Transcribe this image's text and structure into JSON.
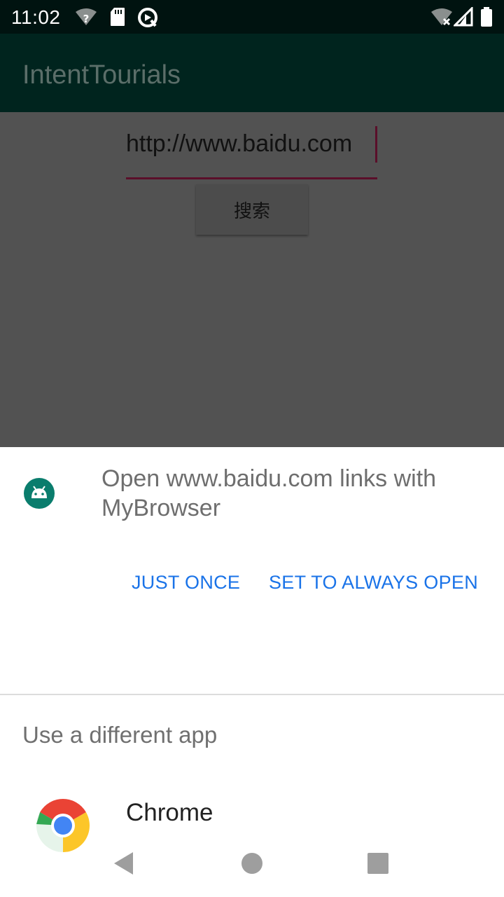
{
  "status_bar": {
    "time": "11:02",
    "icons_left": [
      "wifi-question-icon",
      "sd-card-icon",
      "sync-icon"
    ],
    "icons_right": [
      "wifi-off-icon",
      "signal-icon",
      "battery-icon"
    ]
  },
  "app_bar": {
    "title": "IntentTourials"
  },
  "main": {
    "url_value": "http://www.baidu.com",
    "search_button_label": "搜索"
  },
  "chooser": {
    "title": "Open www.baidu.com links with MyBrowser",
    "app_icon": "android-icon",
    "just_once_label": "JUST ONCE",
    "always_open_label": "SET TO ALWAYS OPEN",
    "different_app_label": "Use a different app",
    "apps": [
      {
        "label": "Chrome",
        "icon": "chrome-icon"
      }
    ]
  },
  "nav_bar": {
    "icons": [
      "back-icon",
      "home-icon",
      "recents-icon"
    ]
  },
  "colors": {
    "status_bar": "#001310",
    "app_bar": "#00241e",
    "scrim_content": "#525252",
    "accent_button_text": "#1a73e8",
    "field_underline": "#5a0f2a"
  }
}
